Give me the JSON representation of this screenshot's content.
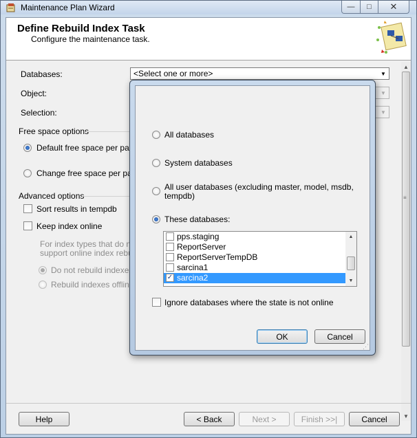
{
  "window": {
    "title": "Maintenance Plan Wizard",
    "minimize": "—",
    "maximize": "□",
    "close": "✕"
  },
  "header": {
    "title": "Define Rebuild Index Task",
    "subtitle": "Configure the maintenance task."
  },
  "form": {
    "databases_label": "Databases:",
    "databases_value": "<Select one or more>",
    "object_label": "Object:",
    "selection_label": "Selection:",
    "free_space_group": "Free space options",
    "default_free_space": "Default free space per page",
    "change_free_space": "Change free space per page",
    "advanced_group": "Advanced options",
    "sort_results": "Sort results in tempdb",
    "keep_index_online": "Keep index online",
    "note_line1": "For index types that do not",
    "note_line2": "support online index rebuilds",
    "do_not_rebuild": "Do not rebuild indexes",
    "rebuild_offline": "Rebuild indexes offline"
  },
  "footer": {
    "help": "Help",
    "back": "< Back",
    "next": "Next >",
    "finish": "Finish >>|",
    "cancel": "Cancel"
  },
  "dialog": {
    "all_databases": "All databases",
    "system_databases": "System databases",
    "all_user_line1": "All user databases  (excluding master, model, msdb,",
    "all_user_line2": "tempdb)",
    "these_databases": "These databases:",
    "list": [
      {
        "name": "pps.staging",
        "checked": false,
        "selected": false
      },
      {
        "name": "ReportServer",
        "checked": false,
        "selected": false
      },
      {
        "name": "ReportServerTempDB",
        "checked": false,
        "selected": false
      },
      {
        "name": "sarcina1",
        "checked": false,
        "selected": false
      },
      {
        "name": "sarcina2",
        "checked": true,
        "selected": true
      }
    ],
    "ignore_offline": "Ignore databases where the state is not online",
    "ok": "OK",
    "cancel": "Cancel"
  }
}
